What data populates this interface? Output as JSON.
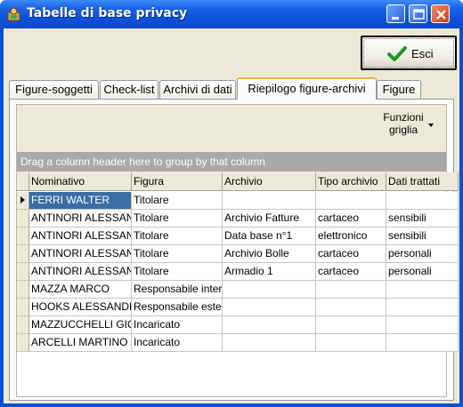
{
  "window": {
    "title": "Tabelle di base privacy",
    "accent": "#0b4ad0"
  },
  "toolbar": {
    "exit_label": "Esci"
  },
  "tabs": [
    {
      "label": "Figure-soggetti",
      "active": false
    },
    {
      "label": "Check-list",
      "active": false
    },
    {
      "label": "Archivi di dati",
      "active": false
    },
    {
      "label": "Riepilogo figure-archivi",
      "active": true
    },
    {
      "label": "Figure",
      "active": false
    }
  ],
  "grid": {
    "functions_label_1": "Funzioni",
    "functions_label_2": "griglia",
    "group_hint": "Drag a column header here to group by that column",
    "columns": [
      "Nominativo",
      "Figura",
      "Archivio",
      "Tipo archivio",
      "Dati trattati"
    ],
    "rows": [
      [
        "FERRI WALTER",
        "Titolare",
        "",
        "",
        ""
      ],
      [
        "ANTINORI ALESSANDRO",
        "Titolare",
        "Archivio Fatture",
        "cartaceo",
        "sensibili"
      ],
      [
        "ANTINORI ALESSANDRO",
        "Titolare",
        "Data base n°1",
        "elettronico",
        "sensibili"
      ],
      [
        "ANTINORI ALESSANDRO",
        "Titolare",
        "Archivio Bolle",
        "cartaceo",
        "personali"
      ],
      [
        "ANTINORI ALESSANDRO",
        "Titolare",
        "Armadio 1",
        "cartaceo",
        "personali"
      ],
      [
        "MAZZA  MARCO",
        "Responsabile interno",
        "",
        "",
        ""
      ],
      [
        "HOOKS ALESSANDRO",
        "Responsabile esterno",
        "",
        "",
        ""
      ],
      [
        "MAZZUCCHELLI GIOVANNI",
        "Incaricato",
        "",
        "",
        ""
      ],
      [
        "ARCELLI MARTINO",
        "Incaricato",
        "",
        "",
        ""
      ]
    ],
    "selected_row": 0
  }
}
